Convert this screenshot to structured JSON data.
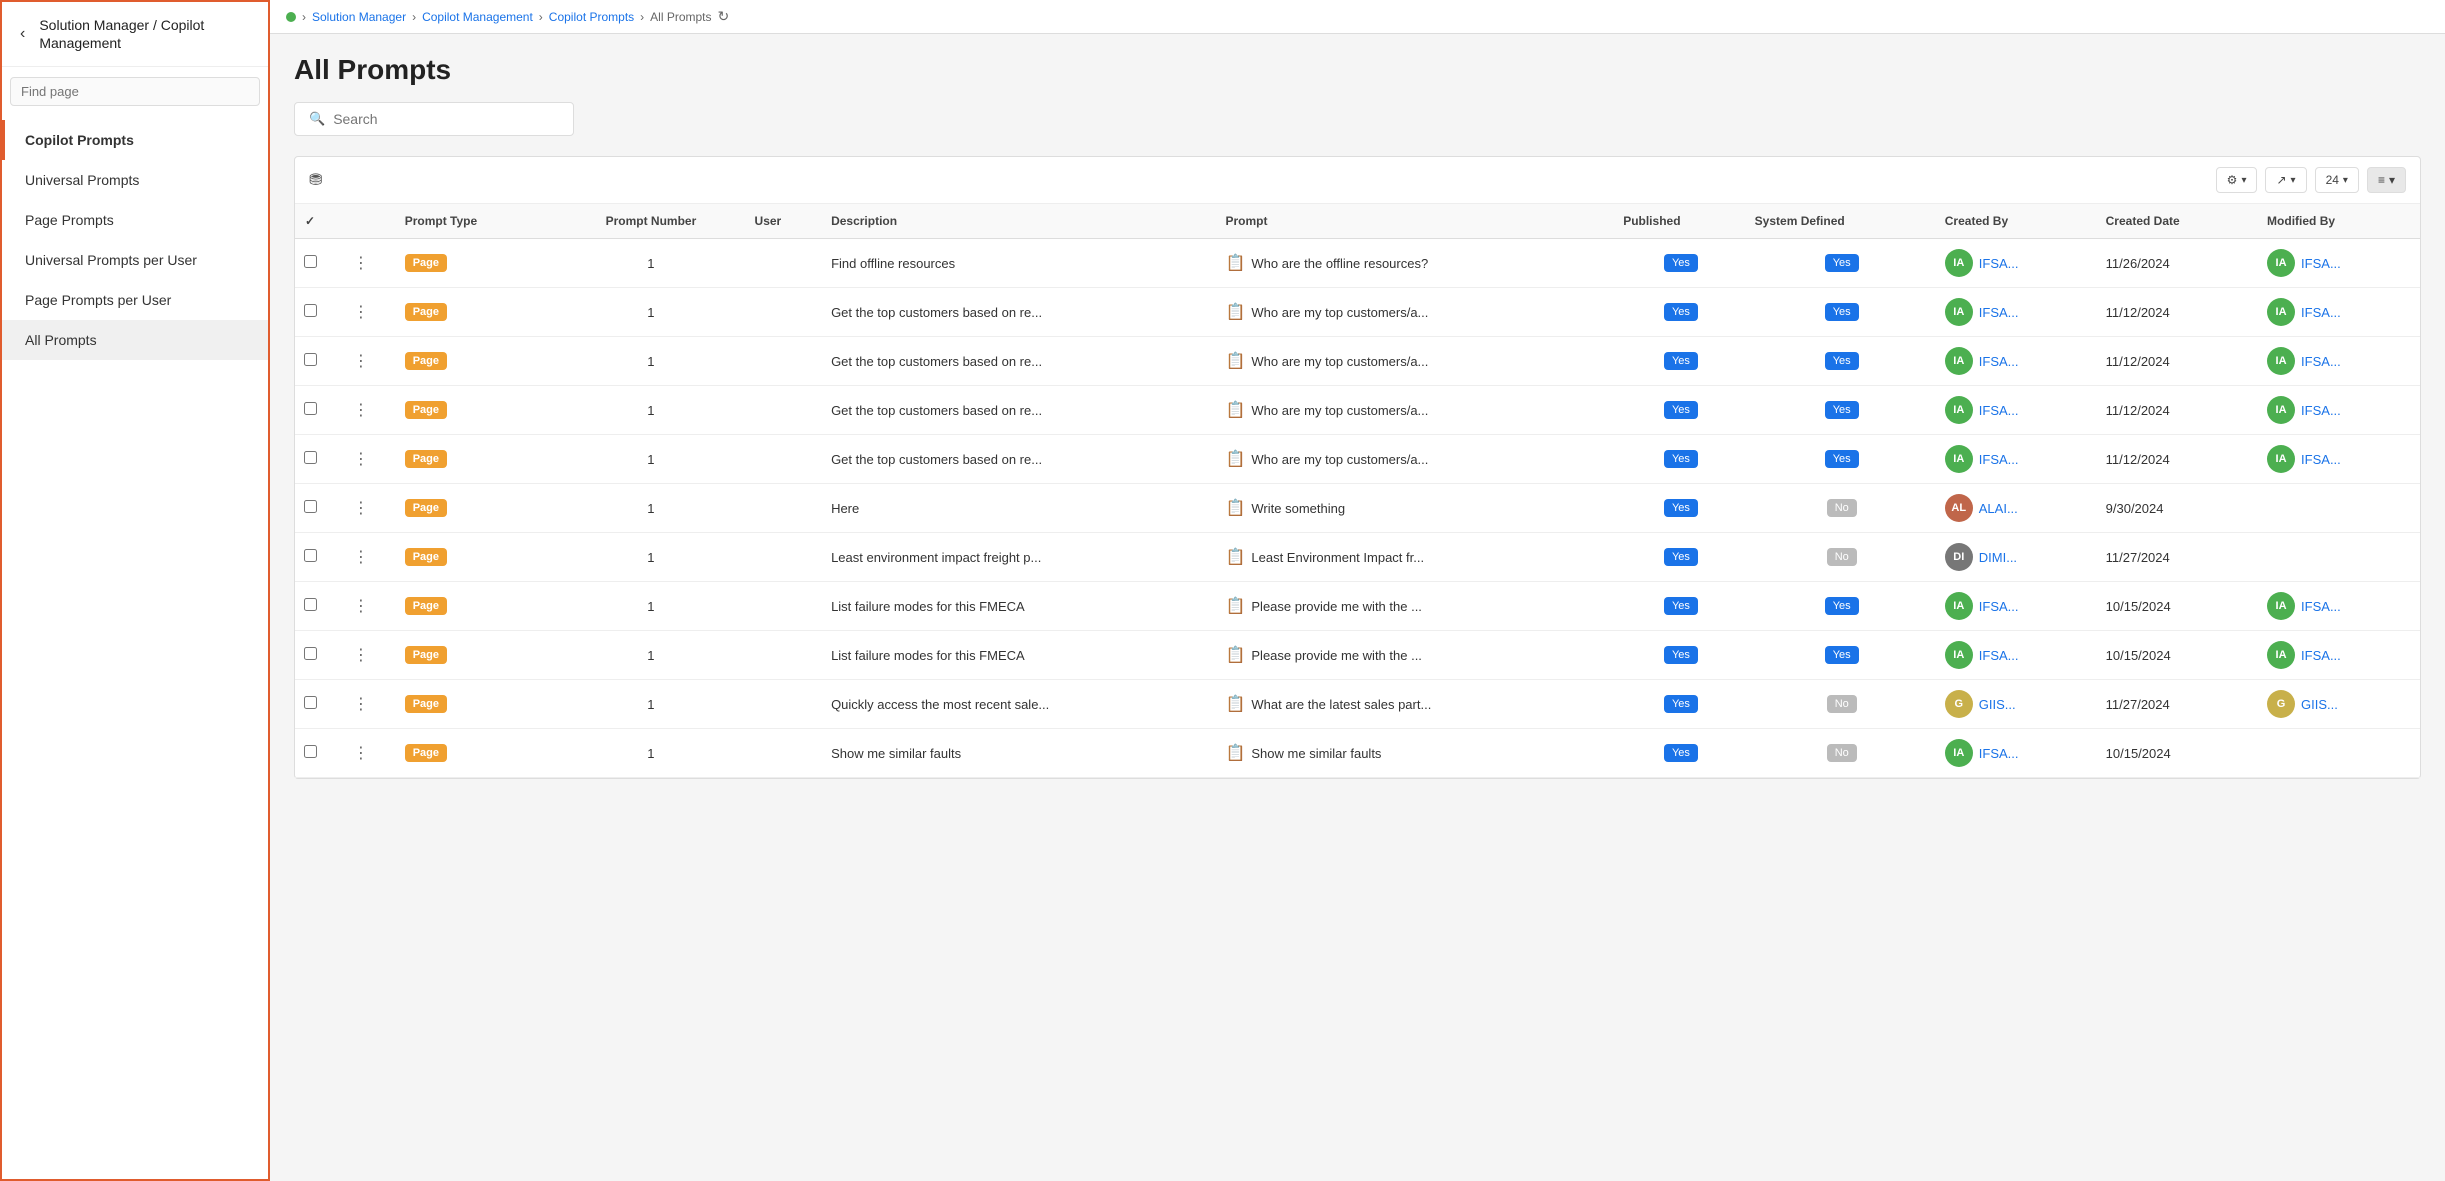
{
  "sidebar": {
    "title": "Solution Manager / Copilot Management",
    "find_page_placeholder": "Find page",
    "nav_items": [
      {
        "id": "copilot-prompts",
        "label": "Copilot Prompts",
        "active": true
      },
      {
        "id": "universal-prompts",
        "label": "Universal Prompts",
        "active": false
      },
      {
        "id": "page-prompts",
        "label": "Page Prompts",
        "active": false
      },
      {
        "id": "universal-prompts-per-user",
        "label": "Universal Prompts per User",
        "active": false
      },
      {
        "id": "page-prompts-per-user",
        "label": "Page Prompts per User",
        "active": false
      },
      {
        "id": "all-prompts",
        "label": "All Prompts",
        "active": false,
        "selected": true
      }
    ]
  },
  "breadcrumb": {
    "items": [
      "Solution Manager",
      "Copilot Management",
      "Copilot Prompts",
      "All Prompts"
    ]
  },
  "page": {
    "title": "All Prompts",
    "search_placeholder": "Search"
  },
  "toolbar": {
    "per_page": "24"
  },
  "table": {
    "columns": [
      "",
      "",
      "Prompt Type",
      "Prompt Number",
      "User",
      "Description",
      "Prompt",
      "Published",
      "System Defined",
      "Created By",
      "Created Date",
      "Modified By"
    ],
    "rows": [
      {
        "type": "Page",
        "number": "1",
        "user": "",
        "description": "Find offline resources",
        "prompt": "Who are the offline resources?",
        "published": "Yes",
        "system_defined": "Yes",
        "created_by_initials": "IA",
        "created_by_name": "IFSA...",
        "created_by_color": "#4caf50",
        "created_date": "11/26/2024",
        "modified_by_initials": "IA",
        "modified_by_name": "IFSA...",
        "modified_by_color": "#4caf50"
      },
      {
        "type": "Page",
        "number": "1",
        "user": "",
        "description": "Get the top customers based on re...",
        "prompt": "Who are my top customers/a...",
        "published": "Yes",
        "system_defined": "Yes",
        "created_by_initials": "IA",
        "created_by_name": "IFSA...",
        "created_by_color": "#4caf50",
        "created_date": "11/12/2024",
        "modified_by_initials": "IA",
        "modified_by_name": "IFSA...",
        "modified_by_color": "#4caf50"
      },
      {
        "type": "Page",
        "number": "1",
        "user": "",
        "description": "Get the top customers based on re...",
        "prompt": "Who are my top customers/a...",
        "published": "Yes",
        "system_defined": "Yes",
        "created_by_initials": "IA",
        "created_by_name": "IFSA...",
        "created_by_color": "#4caf50",
        "created_date": "11/12/2024",
        "modified_by_initials": "IA",
        "modified_by_name": "IFSA...",
        "modified_by_color": "#4caf50"
      },
      {
        "type": "Page",
        "number": "1",
        "user": "",
        "description": "Get the top customers based on re...",
        "prompt": "Who are my top customers/a...",
        "published": "Yes",
        "system_defined": "Yes",
        "created_by_initials": "IA",
        "created_by_name": "IFSA...",
        "created_by_color": "#4caf50",
        "created_date": "11/12/2024",
        "modified_by_initials": "IA",
        "modified_by_name": "IFSA...",
        "modified_by_color": "#4caf50"
      },
      {
        "type": "Page",
        "number": "1",
        "user": "",
        "description": "Get the top customers based on re...",
        "prompt": "Who are my top customers/a...",
        "published": "Yes",
        "system_defined": "Yes",
        "created_by_initials": "IA",
        "created_by_name": "IFSA...",
        "created_by_color": "#4caf50",
        "created_date": "11/12/2024",
        "modified_by_initials": "IA",
        "modified_by_name": "IFSA...",
        "modified_by_color": "#4caf50"
      },
      {
        "type": "Page",
        "number": "1",
        "user": "",
        "description": "Here",
        "prompt": "Write something",
        "published": "Yes",
        "system_defined": "No",
        "created_by_initials": "AL",
        "created_by_name": "ALAI...",
        "created_by_color": "#c0664a",
        "created_by_photo": true,
        "created_date": "9/30/2024",
        "modified_by_initials": "",
        "modified_by_name": "",
        "modified_by_color": ""
      },
      {
        "type": "Page",
        "number": "1",
        "user": "",
        "description": "Least environment impact freight p...",
        "prompt": "Least Environment Impact fr...",
        "published": "Yes",
        "system_defined": "No",
        "created_by_initials": "DI",
        "created_by_name": "DIMI...",
        "created_by_color": "#777",
        "created_by_char": true,
        "created_date": "11/27/2024",
        "modified_by_initials": "",
        "modified_by_name": "",
        "modified_by_color": ""
      },
      {
        "type": "Page",
        "number": "1",
        "user": "",
        "description": "List failure modes for this FMECA",
        "prompt": "Please provide me with the ...",
        "published": "Yes",
        "system_defined": "Yes",
        "created_by_initials": "IA",
        "created_by_name": "IFSA...",
        "created_by_color": "#4caf50",
        "created_date": "10/15/2024",
        "modified_by_initials": "IA",
        "modified_by_name": "IFSA...",
        "modified_by_color": "#4caf50"
      },
      {
        "type": "Page",
        "number": "1",
        "user": "",
        "description": "List failure modes for this FMECA",
        "prompt": "Please provide me with the ...",
        "published": "Yes",
        "system_defined": "Yes",
        "created_by_initials": "IA",
        "created_by_name": "IFSA...",
        "created_by_color": "#4caf50",
        "created_date": "10/15/2024",
        "modified_by_initials": "IA",
        "modified_by_name": "IFSA...",
        "modified_by_color": "#4caf50"
      },
      {
        "type": "Page",
        "number": "1",
        "user": "",
        "description": "Quickly access the most recent sale...",
        "prompt": "What are the latest sales part...",
        "published": "Yes",
        "system_defined": "No",
        "created_by_initials": "G",
        "created_by_name": "GIIS...",
        "created_by_color": "#c8b04a",
        "created_date": "11/27/2024",
        "modified_by_initials": "G",
        "modified_by_name": "GIIS...",
        "modified_by_color": "#c8b04a"
      },
      {
        "type": "Page",
        "number": "1",
        "user": "",
        "description": "Show me similar faults",
        "prompt": "Show me similar faults",
        "published": "Yes",
        "system_defined": "No",
        "created_by_initials": "IA",
        "created_by_name": "IFSA...",
        "created_by_color": "#4caf50",
        "created_date": "10/15/2024",
        "modified_by_initials": "",
        "modified_by_name": "",
        "modified_by_color": ""
      }
    ]
  },
  "icons": {
    "back": "‹",
    "search": "🔍",
    "filter": "⛃",
    "settings": "⚙",
    "export": "↗",
    "list_view": "≡",
    "chevron_down": "▾",
    "dots": "⋮",
    "checkmark": "✓",
    "prompt_doc": "📋",
    "refresh": "↻"
  }
}
